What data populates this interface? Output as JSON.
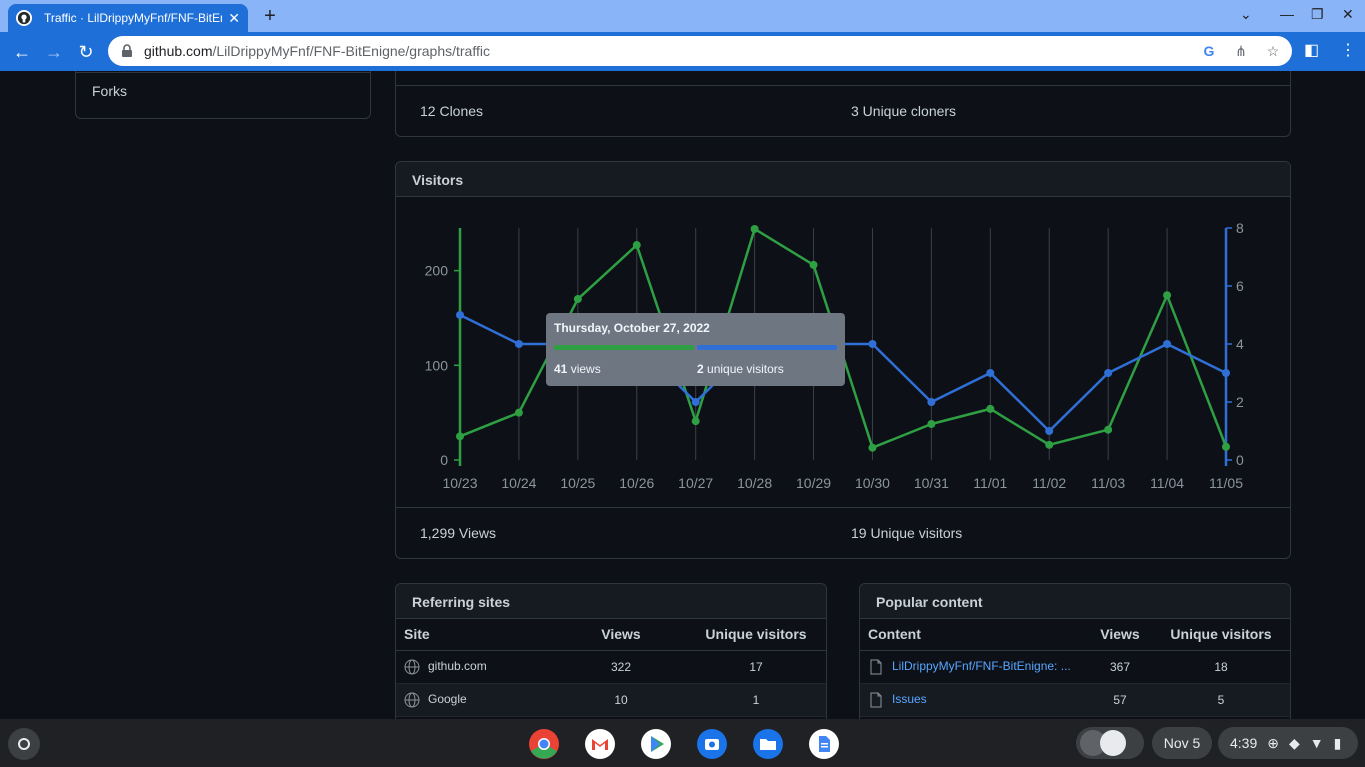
{
  "browser": {
    "tab_title": "Traffic · LilDrippyMyFnf/FNF-BitEnigne/graphs/traffic",
    "new_tab_label": "+",
    "url_host": "github.com",
    "url_path": "/LilDrippyMyFnf/FNF-BitEnigne/graphs/traffic"
  },
  "sidebar": {
    "forks_label": "Forks"
  },
  "clones": {
    "total": "12 Clones",
    "unique": "3 Unique cloners"
  },
  "visitors": {
    "title": "Visitors",
    "total_views": "1,299 Views",
    "unique_visitors": "19 Unique visitors",
    "tooltip": {
      "date": "Thursday, October 27, 2022",
      "views_count": "41",
      "views_label": "views",
      "unique_count": "2",
      "unique_label": "unique visitors"
    }
  },
  "chart_data": {
    "type": "line",
    "categories": [
      "10/23",
      "10/24",
      "10/25",
      "10/26",
      "10/27",
      "10/28",
      "10/29",
      "10/30",
      "10/31",
      "11/01",
      "11/02",
      "11/03",
      "11/04",
      "11/05"
    ],
    "series": [
      {
        "name": "views",
        "axis": "left",
        "color": "#2ea043",
        "values": [
          25,
          50,
          170,
          227,
          41,
          244,
          206,
          13,
          38,
          54,
          16,
          32,
          174,
          14
        ]
      },
      {
        "name": "unique visitors",
        "axis": "right",
        "color": "#2f6fd6",
        "values": [
          5,
          4,
          4,
          4,
          2,
          4,
          4,
          4,
          2,
          3,
          1,
          3,
          4,
          3
        ]
      }
    ],
    "left_ticks": [
      "0",
      "100",
      "200"
    ],
    "right_ticks": [
      "0",
      "2",
      "4",
      "6",
      "8"
    ],
    "left_range": [
      0,
      245
    ],
    "right_range": [
      0,
      8
    ],
    "grid": "vertical",
    "highlight_index": 4
  },
  "referring_sites": {
    "title": "Referring sites",
    "headers": [
      "Site",
      "Views",
      "Unique visitors"
    ],
    "rows": [
      {
        "site": "github.com",
        "views": "322",
        "unique": "17"
      },
      {
        "site": "Google",
        "views": "10",
        "unique": "1"
      }
    ]
  },
  "popular_content": {
    "title": "Popular content",
    "headers": [
      "Content",
      "Views",
      "Unique visitors"
    ],
    "rows": [
      {
        "content": "LilDrippyMyFnf/FNF-BitEnigne: ...",
        "views": "367",
        "unique": "18"
      },
      {
        "content": "Issues",
        "views": "57",
        "unique": "5"
      }
    ]
  },
  "shelf": {
    "date": "Nov 5",
    "time": "4:39"
  },
  "colors": {
    "accent": "#58a6ff",
    "views_green": "#2ea043",
    "unique_blue": "#2f6fd6",
    "chrome_blue": "#1f6fd8"
  }
}
